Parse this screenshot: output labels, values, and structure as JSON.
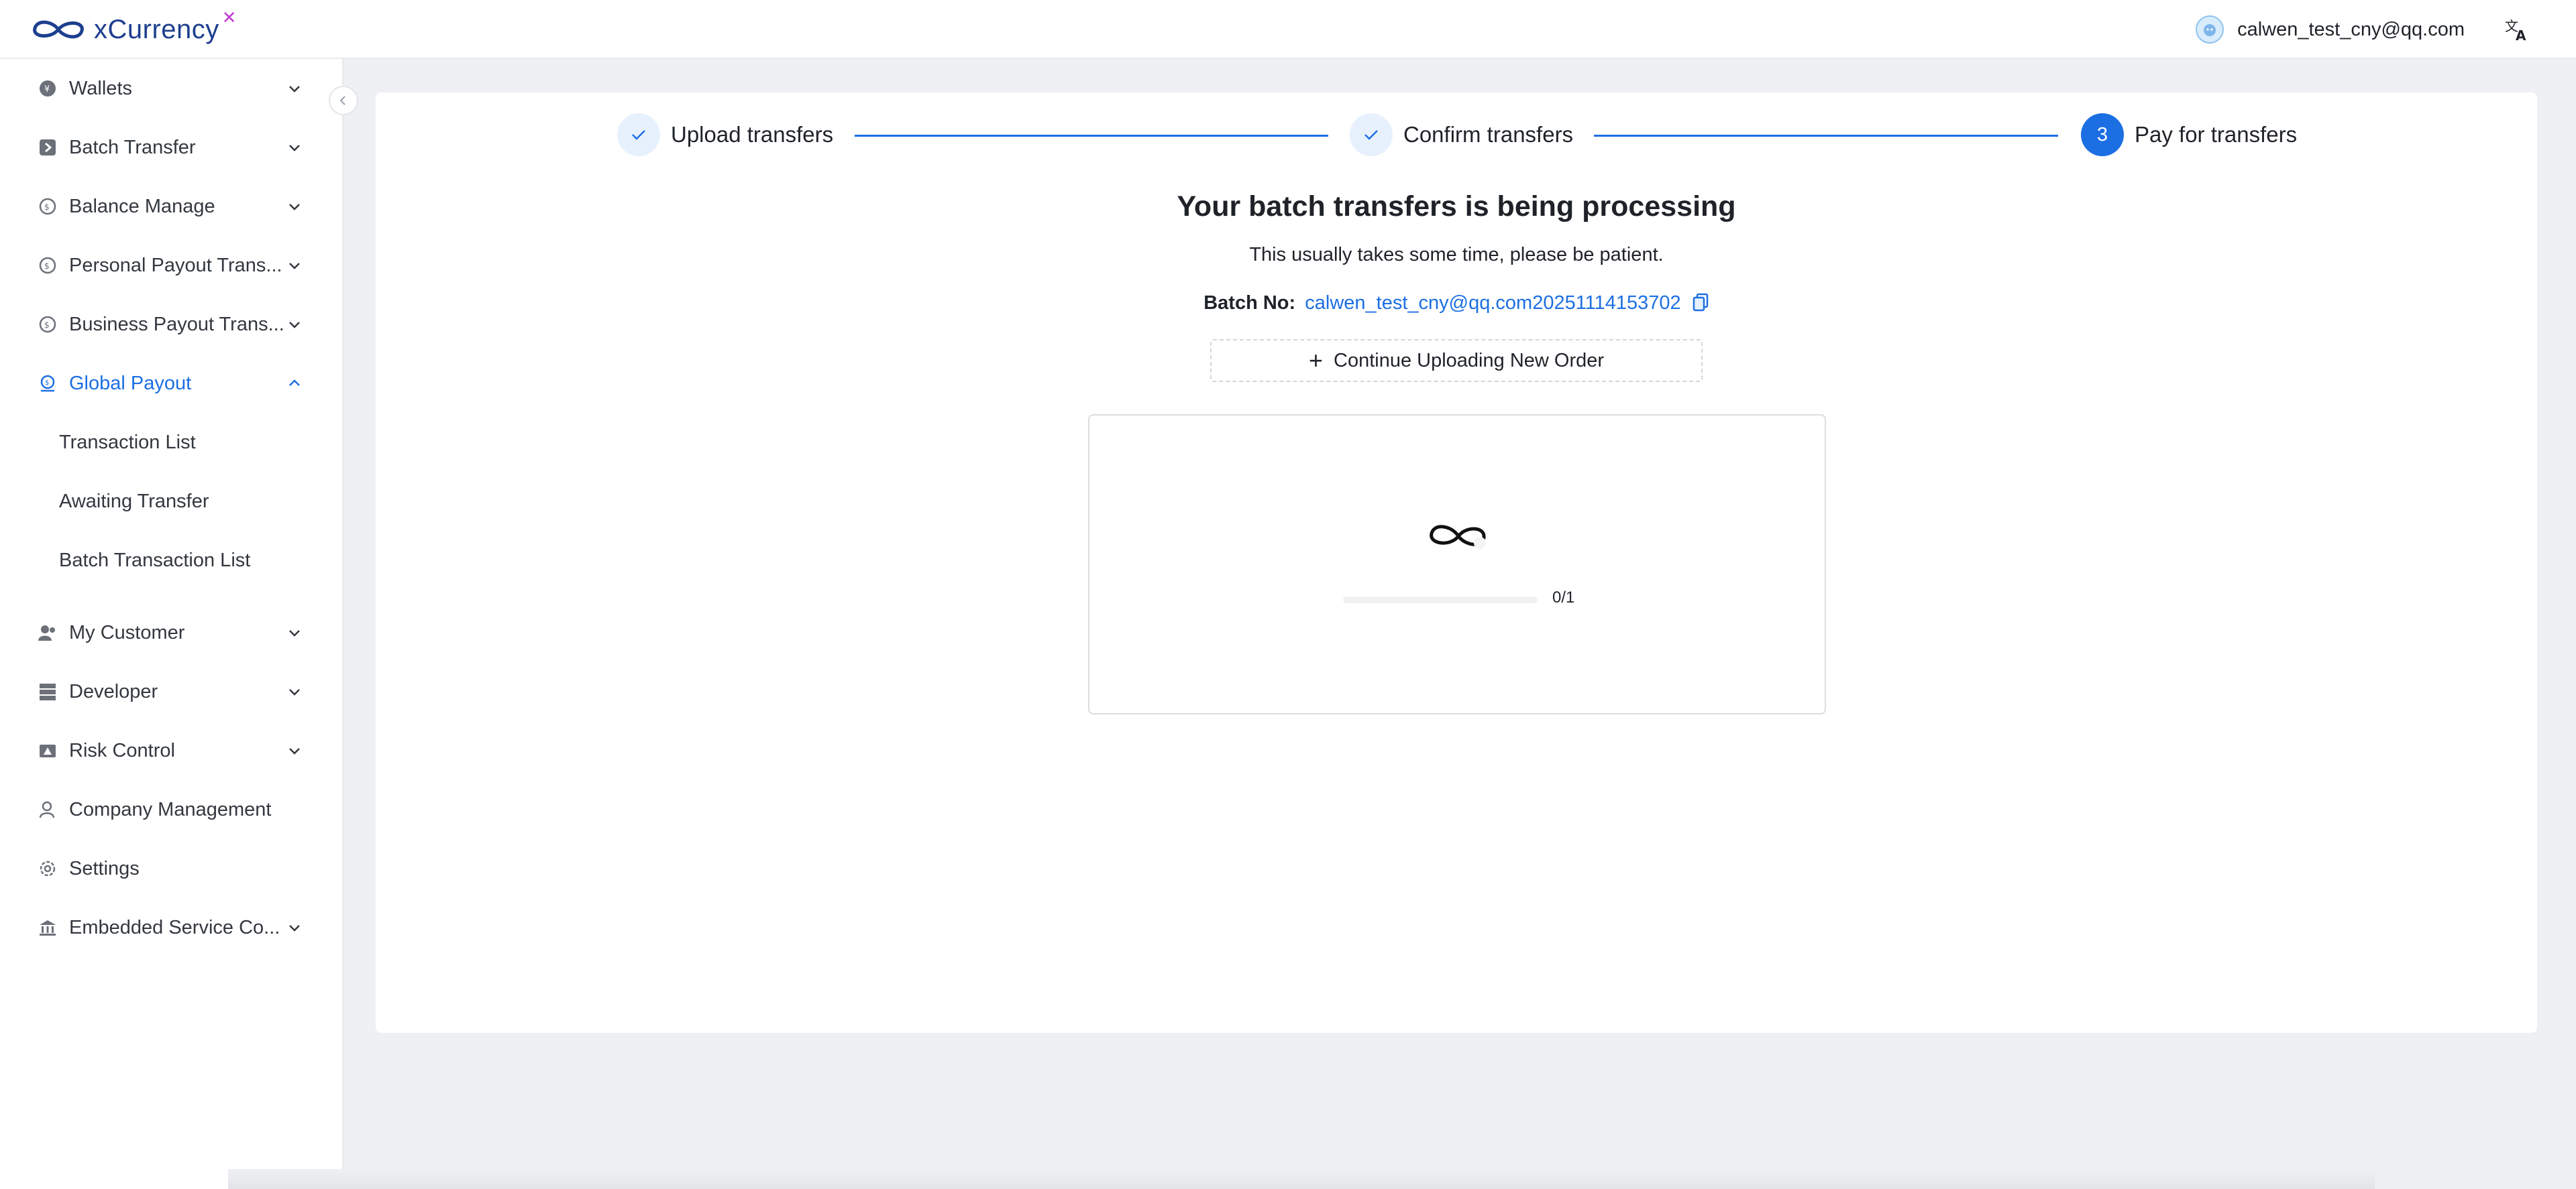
{
  "header": {
    "app_name": "xCurrency",
    "user_email": "calwen_test_cny@qq.com"
  },
  "sidebar": {
    "items": [
      {
        "label": "Wallets"
      },
      {
        "label": "Batch Transfer"
      },
      {
        "label": "Balance Manage"
      },
      {
        "label": "Personal Payout Trans..."
      },
      {
        "label": "Business Payout Trans..."
      },
      {
        "label": "Global Payout"
      },
      {
        "label": "My Customer"
      },
      {
        "label": "Developer"
      },
      {
        "label": "Risk Control"
      },
      {
        "label": "Company Management"
      },
      {
        "label": "Settings"
      },
      {
        "label": "Embedded Service Co..."
      }
    ],
    "global_payout_subitems": [
      {
        "label": "Transaction List"
      },
      {
        "label": "Awaiting Transfer"
      },
      {
        "label": "Batch Transaction List"
      }
    ]
  },
  "steps": [
    {
      "label": "Upload transfers",
      "status": "done"
    },
    {
      "label": "Confirm transfers",
      "status": "done"
    },
    {
      "label": "Pay for transfers",
      "status": "current",
      "number": "3"
    }
  ],
  "main": {
    "title": "Your batch transfers is being processing",
    "subtitle": "This usually takes some time, please be patient.",
    "batch_label": "Batch No:",
    "batch_value": "calwen_test_cny@qq.com20251114153702",
    "continue_label": "Continue Uploading New Order",
    "progress_text": "0/1",
    "progress_fraction": 0
  },
  "colors": {
    "accent": "#1c6fe3",
    "background": "#eef0f4",
    "brand": "#1d3f8f"
  }
}
